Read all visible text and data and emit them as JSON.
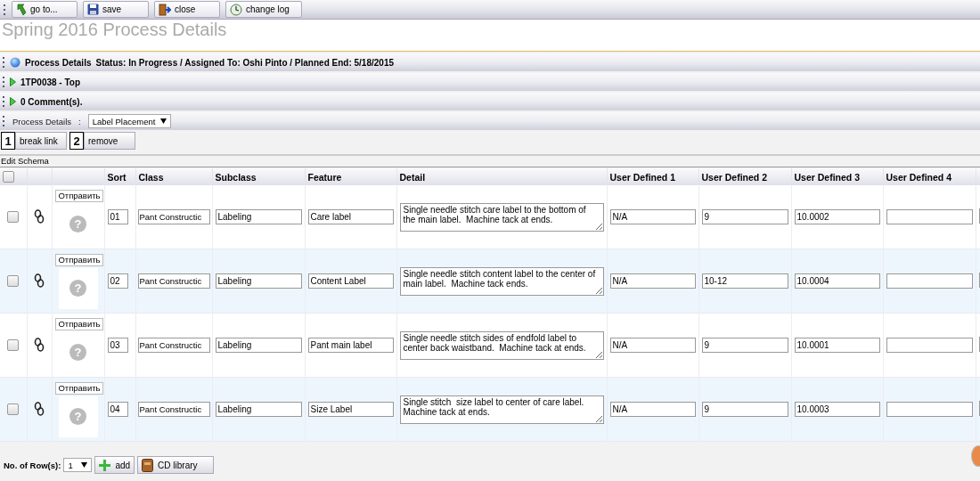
{
  "toolbar": [
    {
      "kind": "goto",
      "label": "go to..."
    },
    {
      "kind": "save",
      "label": "save"
    },
    {
      "kind": "close",
      "label": "close"
    },
    {
      "kind": "log",
      "label": "change log"
    }
  ],
  "title": "Spring 2016 Process Details",
  "sections": [
    {
      "kind": "status",
      "title": "Process Details",
      "text": "Status: In Progress / Assigned To: Oshi Pinto / Planned End: 5/18/2015"
    },
    {
      "kind": "expander",
      "text": "1TP0038 - Top"
    },
    {
      "kind": "expander",
      "text": "0 Comment(s)."
    }
  ],
  "process_details": {
    "label": "Process Details",
    "separator": ":",
    "value": "Label Placement"
  },
  "actions": [
    {
      "number": "1",
      "label": "break link"
    },
    {
      "number": "2",
      "label": "remove"
    }
  ],
  "schema_label": "Edit Schema",
  "table": {
    "header_checked": false,
    "columns": [
      "Sort",
      "Class",
      "Subclass",
      "Feature",
      "Detail",
      "User Defined 1",
      "User Defined 2",
      "User Defined 3",
      "User Defined 4"
    ],
    "rows": [
      {
        "checked": false,
        "send": "Отправить",
        "image": "?",
        "sort": "01",
        "class": "Pant Constructic",
        "subclass": "Labeling",
        "feature": "Care label",
        "detail": "Single needle stitch care label to the bottom of the main label.  Machine tack at ends.",
        "ud1": "N/A",
        "ud2": "9",
        "ud3": "10.0002"
      },
      {
        "checked": false,
        "send": "Отправить",
        "image": "?",
        "sort": "02",
        "class": "Pant Constructic",
        "subclass": "Labeling",
        "feature": "Content Label",
        "detail": "Single needle stitch content label to the center of main label.  Machine tack ends.",
        "ud1": "N/A",
        "ud2": "10-12",
        "ud3": "10.0004"
      },
      {
        "checked": false,
        "send": "Отправить",
        "image": "?",
        "sort": "03",
        "class": "Pant Constructic",
        "subclass": "Labeling",
        "feature": "Pant main label",
        "detail": "Single needle stitch sides of endfold label to center back waistband.  Machine tack at ends.",
        "ud1": "N/A",
        "ud2": "9",
        "ud3": "10.0001"
      },
      {
        "checked": false,
        "send": "Отправить",
        "image": "?",
        "sort": "04",
        "class": "Pant Constructic",
        "subclass": "Labeling",
        "feature": "Size Label",
        "detail": "Single stitch  size label to center of care label.  Machine tack at ends.",
        "ud1": "N/A",
        "ud2": "9",
        "ud3": "10.0003"
      }
    ]
  },
  "footer": {
    "rows_label": "No. of Row(s):",
    "rows_value": "1",
    "buttons": [
      {
        "kind": "add",
        "label": "add"
      },
      {
        "kind": "library",
        "label": "CD library"
      }
    ]
  }
}
